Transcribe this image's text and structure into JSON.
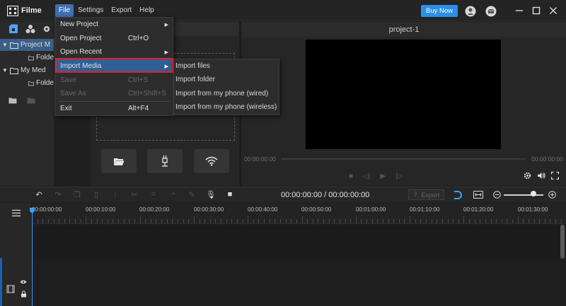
{
  "app": {
    "name": "Filme"
  },
  "menubar": [
    "File",
    "Settings",
    "Export",
    "Help"
  ],
  "titlebar": {
    "buy_now": "Buy Now"
  },
  "tree": {
    "project_item": "Project M",
    "folder_1": "Folde",
    "my_media": "My Med",
    "folder_2": "Folde"
  },
  "file_menu": {
    "items": [
      {
        "label": "New Project",
        "shortcut": "",
        "submenu": true,
        "enabled": true
      },
      {
        "label": "Open Project",
        "shortcut": "Ctrl+O",
        "submenu": false,
        "enabled": true
      },
      {
        "label": "Open Recent",
        "shortcut": "",
        "submenu": true,
        "enabled": true
      },
      {
        "label": "Import Media",
        "shortcut": "",
        "submenu": true,
        "enabled": true,
        "highlighted": true
      },
      {
        "label": "Save",
        "shortcut": "Ctrl+S",
        "submenu": false,
        "enabled": false
      },
      {
        "label": "Save As",
        "shortcut": "Ctrl+Shift+S",
        "submenu": false,
        "enabled": false
      },
      {
        "label": "Exit",
        "shortcut": "Alt+F4",
        "submenu": false,
        "enabled": true
      }
    ]
  },
  "import_submenu": [
    "Import files",
    "Import folder",
    "Import from my phone (wired)",
    "Import from my phone (wireless)"
  ],
  "preview": {
    "title": "project-1",
    "time_start": "00:00:00:00",
    "time_end": "00:00:00:00"
  },
  "timeline": {
    "time_display": "00:00:00:00 / 00:00:00:00",
    "export_label": "Export",
    "ruler": [
      "00:00:00:00",
      "00:00:10:00",
      "00:00:20:00",
      "00:00:30:00",
      "00:00:40:00",
      "00:00:50:00",
      "00:01:00:00",
      "00:01:10:00",
      "00:01:20:00",
      "00:01:30:00"
    ]
  },
  "colors": {
    "accent": "#2b8fe8",
    "highlight_border": "#e0202a",
    "menu_highlight": "#2f5f95",
    "playhead": "#3aa0ff"
  }
}
